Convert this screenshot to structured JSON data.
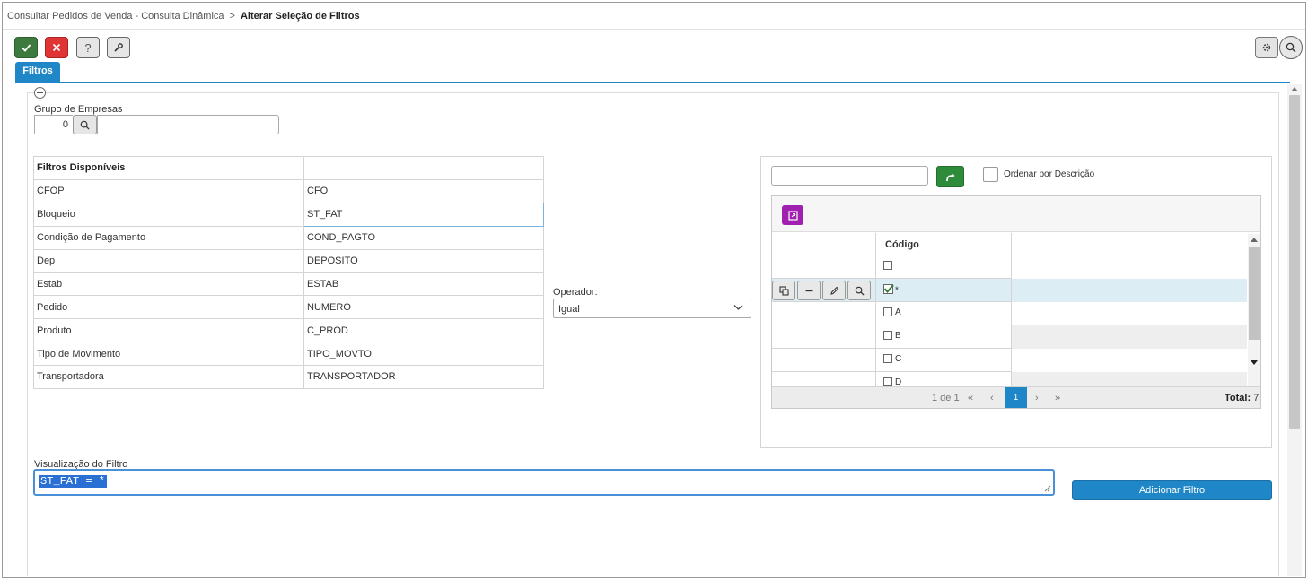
{
  "breadcrumb": {
    "parent": "Consultar Pedidos de Venda - Consulta Dinâmica",
    "separator": ">",
    "current": "Alterar Seleção de Filtros"
  },
  "toolbar": {
    "confirm_icon": "check-icon",
    "cancel_icon": "close-icon",
    "help_label": "?",
    "tool_icon": "wrench-icon",
    "settings_icon": "gear-icon",
    "search_icon": "search-icon"
  },
  "tabs": [
    {
      "label": "Filtros",
      "active": true
    }
  ],
  "grupo_empresas": {
    "label": "Grupo de Empresas",
    "code": "0",
    "description": ""
  },
  "filtros_table": {
    "header": [
      "Filtros Disponíveis",
      ""
    ],
    "rows": [
      {
        "name": "CFOP",
        "field": "CFO"
      },
      {
        "name": "Bloqueio",
        "field": "ST_FAT",
        "selected": true
      },
      {
        "name": "Condição de Pagamento",
        "field": "COND_PAGTO"
      },
      {
        "name": "Dep",
        "field": "DEPOSITO"
      },
      {
        "name": "Estab",
        "field": "ESTAB"
      },
      {
        "name": "Pedido",
        "field": "NUMERO"
      },
      {
        "name": "Produto",
        "field": "C_PROD"
      },
      {
        "name": "Tipo de Movimento",
        "field": "TIPO_MOVTO"
      },
      {
        "name": "Transportadora",
        "field": "TRANSPORTADOR"
      }
    ]
  },
  "operador": {
    "label": "Operador:",
    "value": "Igual"
  },
  "values_panel": {
    "search_value": "",
    "order_label": "Ordenar por Descrição",
    "order_checked": false,
    "column_header": "Código",
    "rows": [
      {
        "code": "",
        "checked": false
      },
      {
        "code": "*",
        "checked": true,
        "highlighted": true
      },
      {
        "code": "A",
        "checked": false
      },
      {
        "code": "B",
        "checked": false
      },
      {
        "code": "C",
        "checked": false
      },
      {
        "code": "D",
        "checked": false
      }
    ],
    "pager": {
      "page_info": "1 de 1",
      "first": "«",
      "prev": "‹",
      "current": "1",
      "next": "›",
      "last": "»",
      "total_label": "Total:",
      "total": "7"
    }
  },
  "visualizacao": {
    "label": "Visualização do Filtro",
    "value": "ST_FAT = *"
  },
  "add_button": {
    "label": "Adicionar Filtro"
  },
  "colors": {
    "accent": "#1f86c7",
    "confirm": "#3d7a3d",
    "cancel": "#e03535",
    "go": "#2e8b3a",
    "purple": "#a020b0",
    "highlight": "#dcedf4"
  }
}
